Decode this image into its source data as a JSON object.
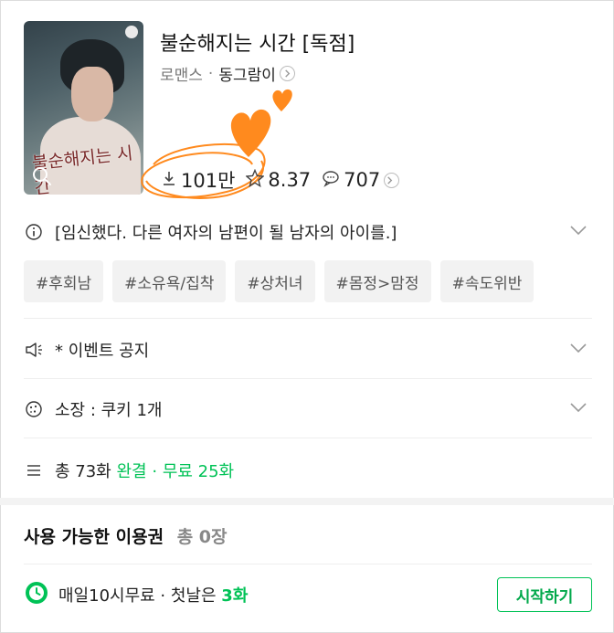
{
  "header": {
    "title": "불순해지는 시간 [독점]",
    "genre": "로맨스",
    "separator": "·",
    "author": "동그람이",
    "cover_title": "불순해지는 시간"
  },
  "stats": {
    "downloads": "101만",
    "rating": "8.37",
    "comments": "707"
  },
  "synopsis": "[임신했다. 다른 여자의 남편이 될 남자의 아이를.]",
  "tags": [
    "#후회남",
    "#소유욕/집착",
    "#상처녀",
    "#몸정>맘정",
    "#속도위반"
  ],
  "notice": "* 이벤트 공지",
  "owned": "소장 : 쿠키 1개",
  "episodes": {
    "total": "총 73화",
    "status": "완결",
    "dot": "·",
    "free": "무료 25화"
  },
  "passes": {
    "title": "사용 가능한 이용권",
    "count": "총 0장"
  },
  "daily_free": {
    "text_prefix": "매일10시무료 · 첫날은",
    "count": "3화",
    "button": "시작하기"
  },
  "colors": {
    "accent_green": "#00c256",
    "heart_orange": "#ff8a1e"
  },
  "icons": [
    "search-icon",
    "download-icon",
    "star-icon",
    "comment-icon",
    "info-icon",
    "megaphone-icon",
    "cookie-icon",
    "list-icon",
    "clock-icon",
    "chevron-down-icon",
    "chevron-right-icon"
  ]
}
